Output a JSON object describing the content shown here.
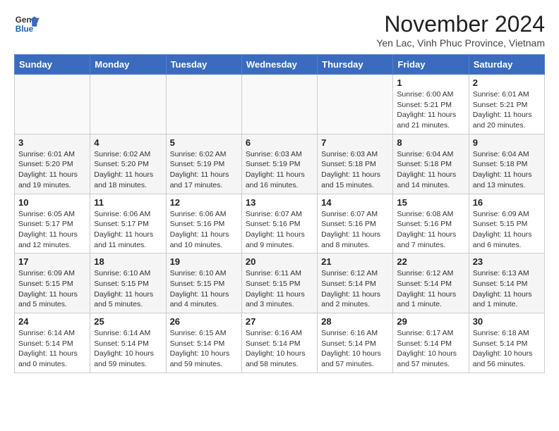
{
  "header": {
    "logo_line1": "General",
    "logo_line2": "Blue",
    "month_title": "November 2024",
    "subtitle": "Yen Lac, Vinh Phuc Province, Vietnam"
  },
  "weekdays": [
    "Sunday",
    "Monday",
    "Tuesday",
    "Wednesday",
    "Thursday",
    "Friday",
    "Saturday"
  ],
  "weeks": [
    [
      {
        "day": "",
        "info": ""
      },
      {
        "day": "",
        "info": ""
      },
      {
        "day": "",
        "info": ""
      },
      {
        "day": "",
        "info": ""
      },
      {
        "day": "",
        "info": ""
      },
      {
        "day": "1",
        "info": "Sunrise: 6:00 AM\nSunset: 5:21 PM\nDaylight: 11 hours and 21 minutes."
      },
      {
        "day": "2",
        "info": "Sunrise: 6:01 AM\nSunset: 5:21 PM\nDaylight: 11 hours and 20 minutes."
      }
    ],
    [
      {
        "day": "3",
        "info": "Sunrise: 6:01 AM\nSunset: 5:20 PM\nDaylight: 11 hours and 19 minutes."
      },
      {
        "day": "4",
        "info": "Sunrise: 6:02 AM\nSunset: 5:20 PM\nDaylight: 11 hours and 18 minutes."
      },
      {
        "day": "5",
        "info": "Sunrise: 6:02 AM\nSunset: 5:19 PM\nDaylight: 11 hours and 17 minutes."
      },
      {
        "day": "6",
        "info": "Sunrise: 6:03 AM\nSunset: 5:19 PM\nDaylight: 11 hours and 16 minutes."
      },
      {
        "day": "7",
        "info": "Sunrise: 6:03 AM\nSunset: 5:18 PM\nDaylight: 11 hours and 15 minutes."
      },
      {
        "day": "8",
        "info": "Sunrise: 6:04 AM\nSunset: 5:18 PM\nDaylight: 11 hours and 14 minutes."
      },
      {
        "day": "9",
        "info": "Sunrise: 6:04 AM\nSunset: 5:18 PM\nDaylight: 11 hours and 13 minutes."
      }
    ],
    [
      {
        "day": "10",
        "info": "Sunrise: 6:05 AM\nSunset: 5:17 PM\nDaylight: 11 hours and 12 minutes."
      },
      {
        "day": "11",
        "info": "Sunrise: 6:06 AM\nSunset: 5:17 PM\nDaylight: 11 hours and 11 minutes."
      },
      {
        "day": "12",
        "info": "Sunrise: 6:06 AM\nSunset: 5:16 PM\nDaylight: 11 hours and 10 minutes."
      },
      {
        "day": "13",
        "info": "Sunrise: 6:07 AM\nSunset: 5:16 PM\nDaylight: 11 hours and 9 minutes."
      },
      {
        "day": "14",
        "info": "Sunrise: 6:07 AM\nSunset: 5:16 PM\nDaylight: 11 hours and 8 minutes."
      },
      {
        "day": "15",
        "info": "Sunrise: 6:08 AM\nSunset: 5:16 PM\nDaylight: 11 hours and 7 minutes."
      },
      {
        "day": "16",
        "info": "Sunrise: 6:09 AM\nSunset: 5:15 PM\nDaylight: 11 hours and 6 minutes."
      }
    ],
    [
      {
        "day": "17",
        "info": "Sunrise: 6:09 AM\nSunset: 5:15 PM\nDaylight: 11 hours and 5 minutes."
      },
      {
        "day": "18",
        "info": "Sunrise: 6:10 AM\nSunset: 5:15 PM\nDaylight: 11 hours and 5 minutes."
      },
      {
        "day": "19",
        "info": "Sunrise: 6:10 AM\nSunset: 5:15 PM\nDaylight: 11 hours and 4 minutes."
      },
      {
        "day": "20",
        "info": "Sunrise: 6:11 AM\nSunset: 5:15 PM\nDaylight: 11 hours and 3 minutes."
      },
      {
        "day": "21",
        "info": "Sunrise: 6:12 AM\nSunset: 5:14 PM\nDaylight: 11 hours and 2 minutes."
      },
      {
        "day": "22",
        "info": "Sunrise: 6:12 AM\nSunset: 5:14 PM\nDaylight: 11 hours and 1 minute."
      },
      {
        "day": "23",
        "info": "Sunrise: 6:13 AM\nSunset: 5:14 PM\nDaylight: 11 hours and 1 minute."
      }
    ],
    [
      {
        "day": "24",
        "info": "Sunrise: 6:14 AM\nSunset: 5:14 PM\nDaylight: 11 hours and 0 minutes."
      },
      {
        "day": "25",
        "info": "Sunrise: 6:14 AM\nSunset: 5:14 PM\nDaylight: 10 hours and 59 minutes."
      },
      {
        "day": "26",
        "info": "Sunrise: 6:15 AM\nSunset: 5:14 PM\nDaylight: 10 hours and 59 minutes."
      },
      {
        "day": "27",
        "info": "Sunrise: 6:16 AM\nSunset: 5:14 PM\nDaylight: 10 hours and 58 minutes."
      },
      {
        "day": "28",
        "info": "Sunrise: 6:16 AM\nSunset: 5:14 PM\nDaylight: 10 hours and 57 minutes."
      },
      {
        "day": "29",
        "info": "Sunrise: 6:17 AM\nSunset: 5:14 PM\nDaylight: 10 hours and 57 minutes."
      },
      {
        "day": "30",
        "info": "Sunrise: 6:18 AM\nSunset: 5:14 PM\nDaylight: 10 hours and 56 minutes."
      }
    ]
  ]
}
